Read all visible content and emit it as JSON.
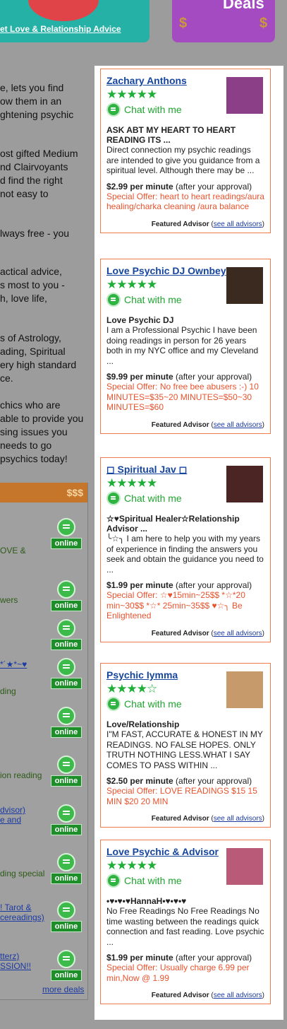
{
  "banners": {
    "left_text": "et Love & Relationship Advice",
    "right_text": "Deals",
    "dollar_left": "$",
    "dollar_right": "$"
  },
  "intro_lines": [
    [
      "e, lets you find",
      "ow them in an",
      "ghtening psychic"
    ],
    [
      "ost gifted Medium",
      "nd Clairvoyants",
      "d find the right",
      "not easy to"
    ],
    [
      "lways free - you"
    ],
    [
      "actical advice,",
      "s most to you -",
      "h, love life,"
    ],
    [
      "s of Astrology,",
      "ading, Spiritual",
      "ery high standard",
      "ce."
    ],
    [
      "chics who are",
      "able to provide you",
      "sing issues you",
      "needs to go",
      "psychics today!"
    ]
  ],
  "deals_panel": {
    "header": "$$$",
    "online_label": "online",
    "more_deals": "more deals",
    "items": [
      {
        "text": "OVE &",
        "link": false
      },
      {
        "text": "wers",
        "link": false
      },
      {
        "text": "",
        "link": false
      },
      {
        "text": "*´★*~♥",
        "link": true
      },
      {
        "text": "ding",
        "link": false
      },
      {
        "text": "",
        "link": false
      },
      {
        "text": "ion reading",
        "link": false
      },
      {
        "text": "dvisor)",
        "link": true,
        "text2": "e and"
      },
      {
        "text": "ding special",
        "link": false
      },
      {
        "text": "! Tarot &",
        "link": true,
        "text2": "cereadings)"
      },
      {
        "text": "tterz)",
        "link": true,
        "text2": "SSION!!"
      }
    ]
  },
  "advisors": [
    {
      "name": "Zachary Anthons",
      "stars": "★★★★★",
      "chat": "Chat with me",
      "title": "ASK ABT MY HEART TO HEART READING ITS ...",
      "desc": "Direct connection my psychic readings are intended to give you guidance from a spiritual level. Although there may be ...",
      "price": "$2.99 per minute",
      "price_note": "(after your approval)",
      "offer": "Special Offer: heart to heart readings/aura healing/charka cleaning /aura balance",
      "thumb_color": "#8b3f86"
    },
    {
      "name": "Love Psychic DJ Ownbey",
      "stars": "★★★★★",
      "chat": "Chat with me",
      "title": "Love Psychic DJ",
      "desc": "I am a Professional Psychic I have been doing readings in person for 26 years both in my NYC office and my Cleveland ...",
      "price": "$9.99 per minute",
      "price_note": "(after your approval)",
      "offer": "Special Offer: No free bee abusers :-) 10 MINUTES=$35~20 MINUTES=$50~30 MINUTES=$60",
      "thumb_color": "#3a2a20"
    },
    {
      "name": "◻ Spiritual Jav ◻",
      "stars": "★★★★★",
      "chat": "Chat with me",
      "title": "☆♥Spiritual Healer☆Relationship Advisor ...",
      "desc": "╰☆╮ I am here to help you with my years of experience in finding the answers you seek and obtain the guidance you need to ...",
      "price": "$1.99 per minute",
      "price_note": "(after your approval)",
      "offer": "Special Offer: ☆♥15min~25$$ *☆*20 min~30$$ *☆* 25min~35$$ ♥☆╮ Be Enlightened",
      "thumb_color": "#4b2424"
    },
    {
      "name": "Psychic Iymma",
      "stars": "★★★★☆",
      "chat": "Chat with me",
      "title": "Love/Relationship",
      "desc": "I\"M FAST, ACCURATE & HONEST IN MY READINGS. NO FALSE HOPES. ONLY TRUTH NOTHING LESS.WHAT I SAY COMES TO PASS WITHIN ...",
      "price": "$2.50 per minute",
      "price_note": "(after your approval)",
      "offer": "Special Offer: LOVE READINGS $15 15 MIN $20 20 MIN",
      "thumb_color": "#c79a6b"
    },
    {
      "name": "Love Psychic & Advisor",
      "stars": "★★★★★",
      "chat": "Chat with me",
      "title": "•♥•♥•♥HannaH•♥•♥•♥",
      "desc": "No Free Readings No Free Readings No time wasting between the readings quick connection and fast reading. Love psychic ...",
      "price": "$1.99 per minute",
      "price_note": "(after your approval)",
      "offer": "Special Offer: Usually charge 6.99 per min,Now @ 1.99",
      "thumb_color": "#b85a78"
    }
  ],
  "footer_label": "Featured Advisor",
  "footer_link": "see all advisors"
}
